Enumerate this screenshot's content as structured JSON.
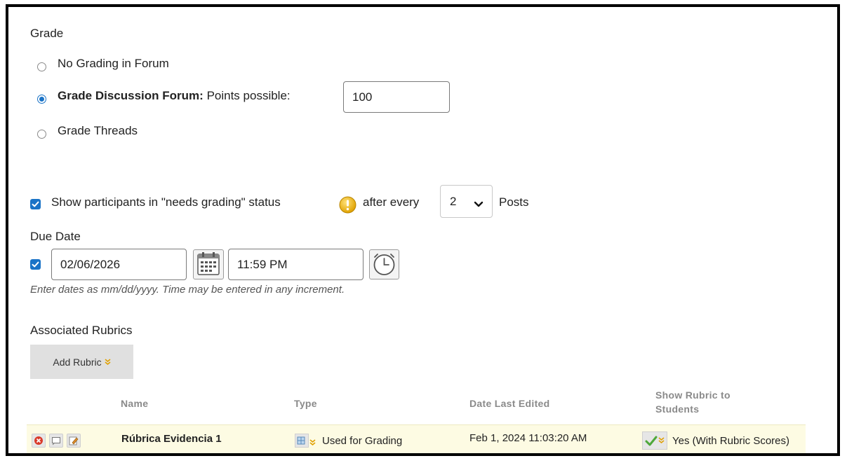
{
  "grade": {
    "heading": "Grade",
    "options": [
      {
        "label": "No Grading in Forum",
        "selected": false
      },
      {
        "label_bold": "Grade Discussion Forum:",
        "label_suffix": "Points possible:",
        "selected": true,
        "points_value": "100"
      },
      {
        "label": "Grade Threads",
        "selected": false
      }
    ]
  },
  "needs_grading": {
    "checked": true,
    "label_before": "Show participants in \"needs grading\" status",
    "label_mid": "after every",
    "select_value": "2",
    "label_after": "Posts"
  },
  "due_date": {
    "heading": "Due Date",
    "checked": true,
    "date_value": "02/06/2026",
    "time_value": "11:59 PM",
    "hint": "Enter dates as mm/dd/yyyy. Time may be entered in any increment."
  },
  "rubrics": {
    "heading": "Associated Rubrics",
    "add_button": "Add Rubric",
    "columns": {
      "name": "Name",
      "type": "Type",
      "date": "Date Last Edited",
      "show_line1": "Show Rubric to",
      "show_line2": "Students"
    },
    "rows": [
      {
        "name": "Rúbrica Evidencia 1",
        "type": "Used for Grading",
        "date": "Feb 1, 2024 11:03:20 AM",
        "show": "Yes (With Rubric Scores)"
      }
    ]
  },
  "colors": {
    "accent": "#1a73c7",
    "row_highlight": "#fdfbe3",
    "warning": "#f2b705"
  }
}
